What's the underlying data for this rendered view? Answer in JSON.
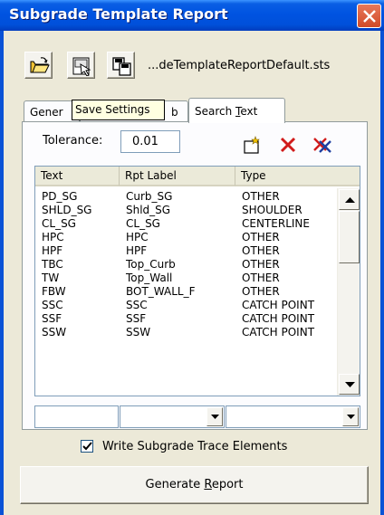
{
  "window": {
    "title": "Subgrade Template Report"
  },
  "toolbar": {
    "path": "...deTemplateReportDefault.sts"
  },
  "tooltip": "Save Settings",
  "tabs": [
    {
      "label": "Gener",
      "mnemonic": ""
    },
    {
      "label_start": "",
      "label_end": "b"
    },
    {
      "label_start": "Search ",
      "mnemonic": "T",
      "label_end": "ext"
    }
  ],
  "tolerance": {
    "label": "Tolerance:",
    "value": "0.01"
  },
  "table": {
    "headers": [
      "Text",
      "Rpt Label",
      "Type"
    ],
    "rows": [
      {
        "text": "PD_SG",
        "label": "Curb_SG",
        "type": "OTHER"
      },
      {
        "text": "SHLD_SG",
        "label": "Shld_SG",
        "type": "SHOULDER"
      },
      {
        "text": "CL_SG",
        "label": "CL_SG",
        "type": "CENTERLINE"
      },
      {
        "text": "HPC",
        "label": "HPC",
        "type": "OTHER"
      },
      {
        "text": "HPF",
        "label": "HPF",
        "type": "OTHER"
      },
      {
        "text": "TBC",
        "label": "Top_Curb",
        "type": "OTHER"
      },
      {
        "text": "TW",
        "label": "Top_Wall",
        "type": "OTHER"
      },
      {
        "text": "FBW",
        "label": "BOT_WALL_F",
        "type": "OTHER"
      },
      {
        "text": "SSC",
        "label": "SSC",
        "type": "CATCH POINT"
      },
      {
        "text": "SSF",
        "label": "SSF",
        "type": "CATCH POINT"
      },
      {
        "text": "SSW",
        "label": "SSW",
        "type": "CATCH POINT"
      }
    ]
  },
  "checkbox": {
    "label": "Write Subgrade Trace Elements",
    "checked": true
  },
  "generate": {
    "label_start": "Generate ",
    "mnemonic": "R",
    "label_end": "eport"
  },
  "colors": {
    "title_bar": "#0053E1",
    "window_bg": "#ECE9D8",
    "close_button": "#D14A28"
  }
}
